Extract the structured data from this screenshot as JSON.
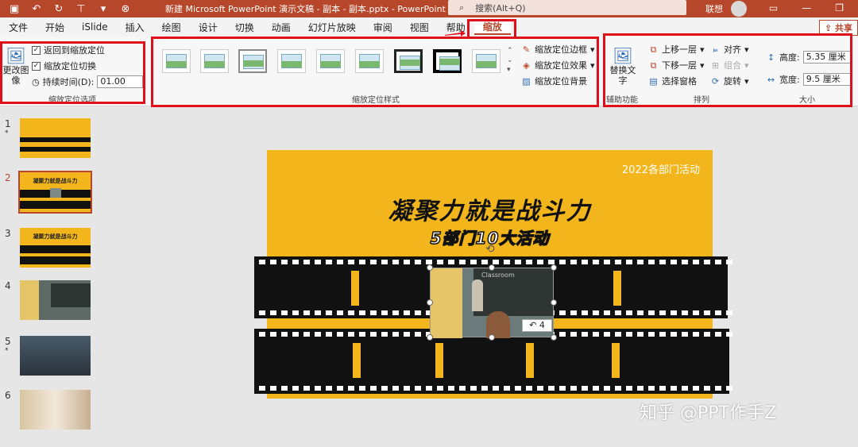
{
  "window": {
    "title": "新建 Microsoft PowerPoint 演示文稿 - 副本 - 副本.pptx  -  PowerPoint",
    "search_placeholder": "搜索(Alt+Q)",
    "user": "联想",
    "accent": "#b7472a"
  },
  "tabs": [
    {
      "label": "文件"
    },
    {
      "label": "开始"
    },
    {
      "label": "iSlide"
    },
    {
      "label": "插入"
    },
    {
      "label": "绘图"
    },
    {
      "label": "设计"
    },
    {
      "label": "切换"
    },
    {
      "label": "动画"
    },
    {
      "label": "幻灯片放映"
    },
    {
      "label": "审阅"
    },
    {
      "label": "视图"
    },
    {
      "label": "帮助"
    },
    {
      "label": "缩放"
    }
  ],
  "share": "共享",
  "ribbon": {
    "zoom_options": {
      "change_image": "更改图像",
      "return_zoom": "返回到缩放定位",
      "zoom_transition": "缩放定位切换",
      "duration_label": "持续时间(D):",
      "duration_value": "01.00",
      "group_label": "缩放定位选项"
    },
    "styles": {
      "border": "缩放定位边框",
      "effect": "缩放定位效果",
      "background": "缩放定位背景",
      "group_label": "缩放定位样式"
    },
    "accessibility": {
      "alt_text": "替换文字",
      "group_label": "辅助功能"
    },
    "arrange": {
      "bring_forward": "上移一层",
      "send_backward": "下移一层",
      "selection_pane": "选择窗格",
      "align": "对齐",
      "group": "组合",
      "rotate": "旋转",
      "group_label": "排列"
    },
    "size": {
      "height_label": "高度:",
      "height_value": "5.35 厘米",
      "width_label": "宽度:",
      "width_value": "9.5 厘米",
      "group_label": "大小"
    }
  },
  "slides": [
    {
      "num": "1",
      "star": "*"
    },
    {
      "num": "2",
      "star": ""
    },
    {
      "num": "3",
      "star": ""
    },
    {
      "num": "4",
      "star": ""
    },
    {
      "num": "5",
      "star": "*"
    },
    {
      "num": "6",
      "star": ""
    }
  ],
  "slide2_thumb_title": "凝聚力就是战斗力",
  "slide3_thumb_title": "凝聚力就是战斗力",
  "slide": {
    "corner": "2022各部门活动",
    "title": "凝聚力就是战斗力",
    "subtitle": "5部门10大活动",
    "photo_badge": "4",
    "photo_board_text": "Classroom"
  },
  "watermark": "知乎 @PPT作手Z"
}
